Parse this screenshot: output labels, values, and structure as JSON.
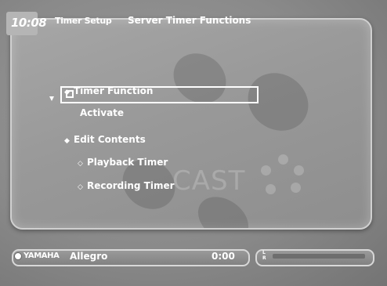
{
  "header": {
    "clock": "10:08",
    "breadcrumb_section": "Timer Setup",
    "page_title": "Server Timer Functions"
  },
  "menu": {
    "timer_function": "Timer Function",
    "activate": "Activate",
    "edit_contents": "Edit Contents",
    "playback_timer": "Playback Timer",
    "recording_timer": "Recording Timer",
    "activate_checked": false
  },
  "background": {
    "watermark_text": "CAST"
  },
  "status_bar": {
    "brand": "YAMAHA",
    "track": "Allegro",
    "time": "0:00",
    "channel_left": "L",
    "channel_right": "R"
  }
}
